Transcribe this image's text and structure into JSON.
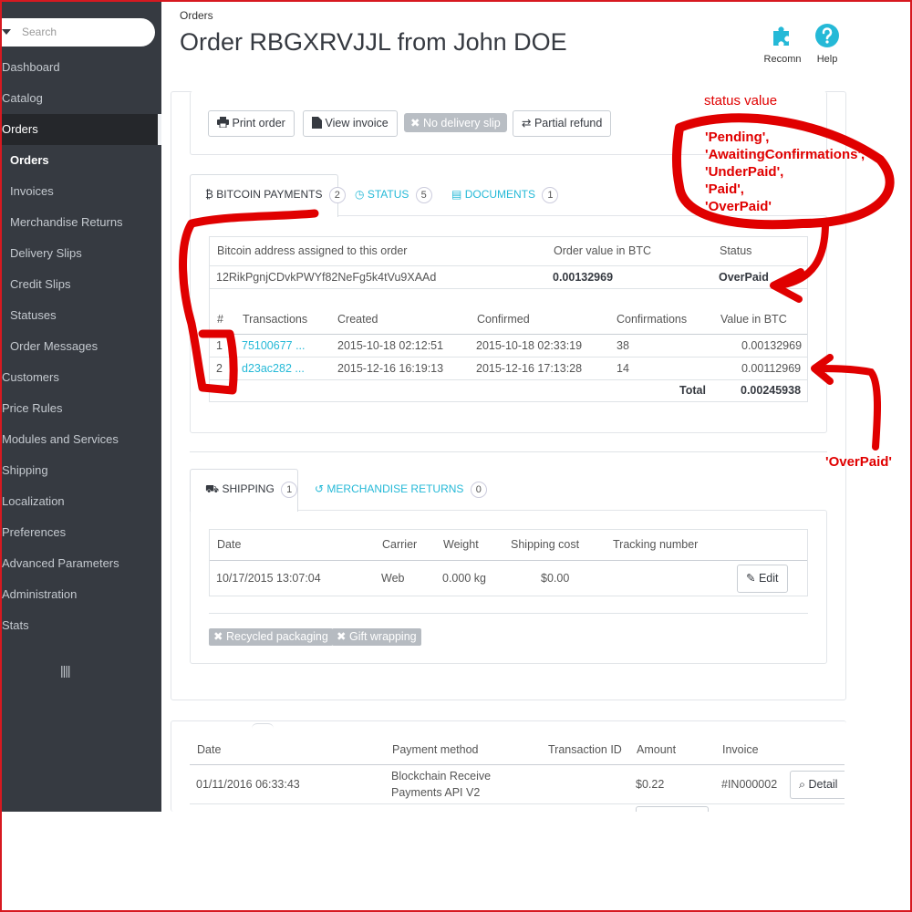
{
  "sidebar": {
    "search_placeholder": "Search",
    "items": [
      {
        "label": "Dashboard"
      },
      {
        "label": "Catalog"
      },
      {
        "label": "Orders"
      },
      {
        "label": "Orders"
      },
      {
        "label": "Invoices"
      },
      {
        "label": "Merchandise Returns"
      },
      {
        "label": "Delivery Slips"
      },
      {
        "label": "Credit Slips"
      },
      {
        "label": "Statuses"
      },
      {
        "label": "Order Messages"
      },
      {
        "label": "Customers"
      },
      {
        "label": "Price Rules"
      },
      {
        "label": "Modules and Services"
      },
      {
        "label": "Shipping"
      },
      {
        "label": "Localization"
      },
      {
        "label": "Preferences"
      },
      {
        "label": "Advanced Parameters"
      },
      {
        "label": "Administration"
      },
      {
        "label": "Stats"
      }
    ]
  },
  "header": {
    "breadcrumb": "Orders",
    "title": "Order RBGXRVJJL from John DOE",
    "recommended_label": "Recomn",
    "help_label": "Help"
  },
  "actions": {
    "print_order": "Print order",
    "view_invoice": "View invoice",
    "no_delivery_slip": "No delivery slip",
    "partial_refund": "Partial refund"
  },
  "tabs": {
    "bitcoin": {
      "label": "BITCOIN PAYMENTS",
      "count": "2"
    },
    "status": {
      "label": "STATUS",
      "count": "5"
    },
    "documents": {
      "label": "DOCUMENTS",
      "count": "1"
    }
  },
  "bitcoin_summary": {
    "headers": [
      "Bitcoin address assigned to this order",
      "Order value in BTC",
      "Status"
    ],
    "address": "12RikPgnjCDvkPWYf82NeFg5k4tVu9XAAd",
    "order_value": "0.00132969",
    "status": "OverPaid"
  },
  "transactions": {
    "headers": [
      "#",
      "Transactions",
      "Created",
      "Confirmed",
      "Confirmations",
      "Value in BTC"
    ],
    "rows": [
      {
        "num": "1",
        "tx": "75100677 ...",
        "created": "2015-10-18 02:12:51",
        "confirmed": "2015-10-18 02:33:19",
        "confirmations": "38",
        "value": "0.00132969"
      },
      {
        "num": "2",
        "tx": "d23ac282 ...",
        "created": "2015-12-16 16:19:13",
        "confirmed": "2015-12-16 17:13:28",
        "confirmations": "14",
        "value": "0.00112969"
      }
    ],
    "total_label": "Total",
    "total_value": "0.00245938"
  },
  "shipping_tabs": {
    "shipping": {
      "label": "SHIPPING",
      "count": "1"
    },
    "returns": {
      "label": "MERCHANDISE RETURNS",
      "count": "0"
    }
  },
  "shipping_table": {
    "headers": [
      "Date",
      "Carrier",
      "Weight",
      "Shipping cost",
      "Tracking number"
    ],
    "row": {
      "date": "10/17/2015 13:07:04",
      "carrier": "Web",
      "weight": "0.000 kg",
      "cost": "$0.00"
    },
    "edit_label": "Edit"
  },
  "shipping_tags": {
    "recycled": "Recycled packaging",
    "gift": "Gift wrapping"
  },
  "payments_table": {
    "headers": [
      "Date",
      "Payment method",
      "Transaction ID",
      "Amount",
      "Invoice"
    ],
    "row": {
      "date": "01/11/2016 06:33:43",
      "method_line1": "Blockchain Receive",
      "method_line2": "Payments API V2",
      "amount": "$0.22",
      "invoice": "#IN000002"
    },
    "details_label": "Detail"
  },
  "annotations": {
    "status_title": "status value",
    "status_values": [
      "'Pending',",
      "'AwaitingConfirmations',",
      "'UnderPaid',",
      "'Paid',",
      "'OverPaid'"
    ],
    "overpaid": "'OverPaid'"
  },
  "colors": {
    "sidebar_bg": "#363a41",
    "accent": "#25b9d7",
    "annotation": "#e00000"
  }
}
